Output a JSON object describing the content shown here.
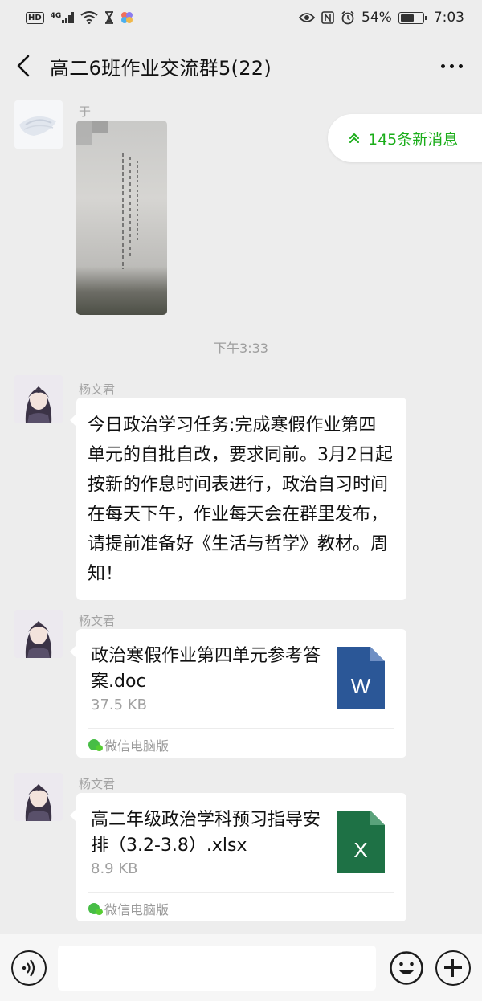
{
  "status_bar": {
    "hd_label": "HD",
    "network_label": "4G",
    "battery_text": "54%",
    "battery_level": 0.54,
    "time": "7:03"
  },
  "header": {
    "title": "高二6班作业交流群5(22)"
  },
  "new_messages_label": "145条新消息",
  "messages": [
    {
      "type": "image",
      "sender": "于"
    },
    {
      "type": "timestamp",
      "text": "下午3:33"
    },
    {
      "type": "text",
      "sender": "杨文君",
      "text": "今日政治学习任务:完成寒假作业第四单元的自批自改，要求同前。3月2日起按新的作息时间表进行，政治自习时间在每天下午，作业每天会在群里发布，请提前准备好《生活与哲学》教材。周知！"
    },
    {
      "type": "file",
      "sender": "杨文君",
      "file_name": "政治寒假作业第四单元参考答案.doc",
      "file_size": "37.5 KB",
      "icon_letter": "W",
      "icon_color": "#2b5797",
      "source": "微信电脑版"
    },
    {
      "type": "file",
      "sender": "杨文君",
      "file_name": "高二年级政治学科预习指导安排（3.2-3.8）.xlsx",
      "file_size": "8.9 KB",
      "icon_letter": "X",
      "icon_color": "#1e7145",
      "source": "微信电脑版"
    }
  ],
  "colors": {
    "background": "#ededed",
    "accent_green": "#1aad19"
  }
}
